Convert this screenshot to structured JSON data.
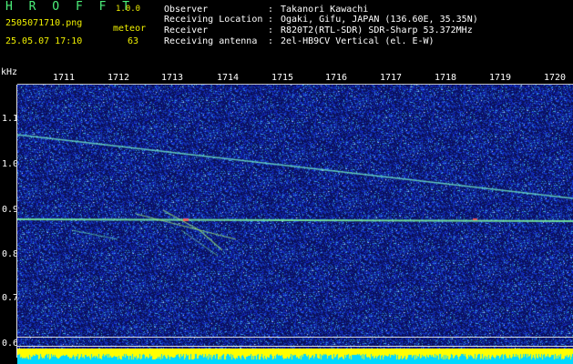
{
  "header": {
    "app_title": "H R O F F T",
    "app_version": "1.0.0",
    "file_name": "2505071710.png",
    "meteor_label": "meteor",
    "date_time": "25.05.07 17:10",
    "meteor_count": "63"
  },
  "info": [
    {
      "key": "Observer",
      "sep": ":",
      "value": "Takanori Kawachi"
    },
    {
      "key": "Receiving Location",
      "sep": ":",
      "value": "Ogaki, Gifu, JAPAN (136.60E, 35.35N)"
    },
    {
      "key": "Receiver",
      "sep": ":",
      "value": "R820T2(RTL-SDR) SDR-Sharp 53.372MHz"
    },
    {
      "key": "Receiving antenna",
      "sep": ":",
      "value": "2el-HB9CV Vertical (el. E-W)"
    }
  ],
  "axes": {
    "y_unit": "kHz",
    "x_ticks": [
      "1711",
      "1712",
      "1713",
      "1714",
      "1715",
      "1716",
      "1717",
      "1718",
      "1719",
      "1720"
    ],
    "y_ticks": [
      "1.1",
      "1.0",
      "0.9",
      "0.8",
      "0.7",
      "0.6"
    ]
  },
  "colors": {
    "background": "#000000",
    "noise": "#1a2aa8",
    "header_green": "#4cf07a",
    "header_yellow": "#f0f000",
    "level_yellow": "#ffff00",
    "level_cyan": "#00e0ff"
  }
}
